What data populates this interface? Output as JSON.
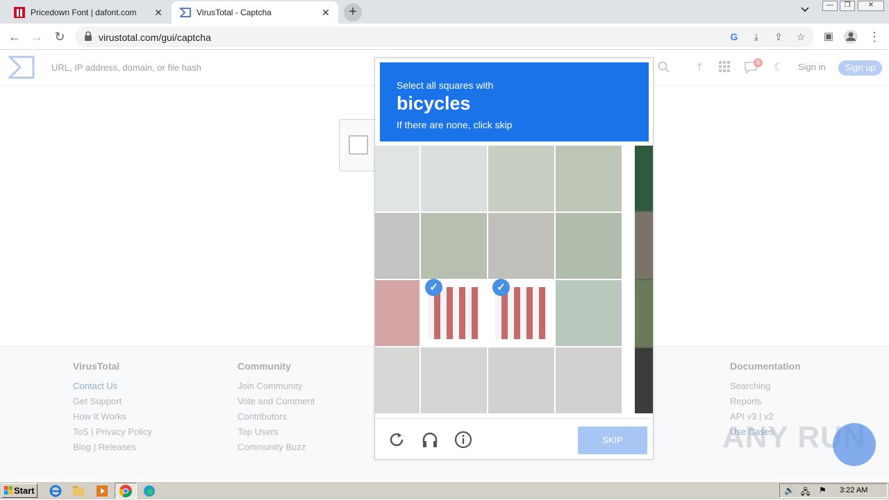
{
  "browser": {
    "tabs": [
      {
        "title": "Pricedown Font | dafont.com",
        "active": false
      },
      {
        "title": "VirusTotal - Captcha",
        "active": true
      }
    ],
    "new_tab": "+",
    "tab_menu": "⌄",
    "url": "virustotal.com/gui/captcha"
  },
  "vt": {
    "search_placeholder": "URL, IP address, domain, or file hash",
    "notif_count": "8",
    "sign_in": "Sign in",
    "sign_up": "Sign up"
  },
  "footer": {
    "columns": [
      {
        "title": "VirusTotal",
        "links": [
          "Contact Us",
          "Get Support",
          "How It Works",
          "ToS | Privacy Policy",
          "Blog | Releases"
        ]
      },
      {
        "title": "Community",
        "links": [
          "Join Community",
          "Vote and Comment",
          "Contributors",
          "Top Users",
          "Community Buzz"
        ]
      },
      {
        "title": "Documentation",
        "links": [
          "Searching",
          "Reports",
          "API v3 | v2",
          "Use Cases"
        ]
      }
    ]
  },
  "captcha": {
    "line1": "Select all squares with",
    "target": "bicycles",
    "line3": "If there are none, click skip",
    "skip": "SKIP",
    "selected_cells": [
      9,
      10
    ]
  },
  "watermark": "ANY RUN",
  "taskbar": {
    "start": "Start",
    "clock": "3:22 AM"
  }
}
